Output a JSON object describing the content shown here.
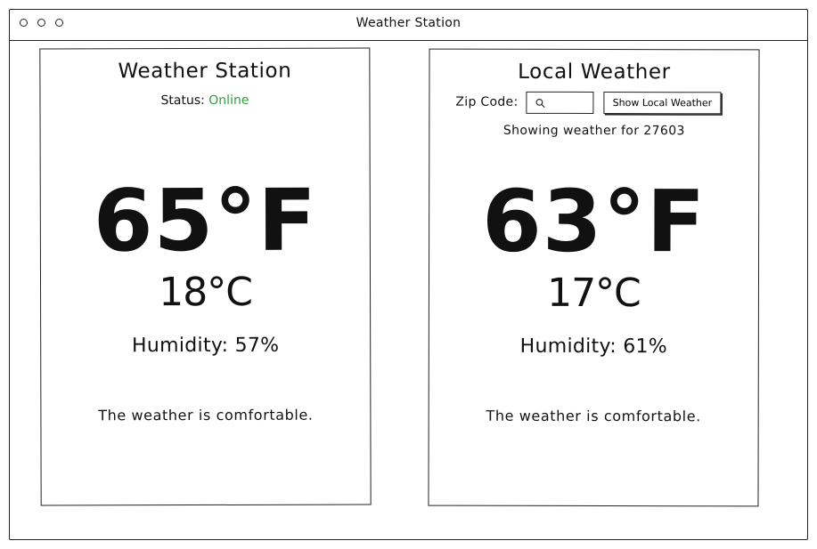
{
  "window": {
    "title": "Weather Station"
  },
  "station": {
    "title": "Weather Station",
    "status_label": "Status:",
    "status_value": "Online",
    "temp_f": "65°F",
    "temp_c": "18°C",
    "humidity": "Humidity: 57%",
    "comfort": "The weather is comfortable."
  },
  "local": {
    "title": "Local Weather",
    "zip_label": "Zip Code:",
    "zip_value": "",
    "zip_placeholder": "",
    "button_label": "Show Local Weather",
    "showing": "Showing weather for 27603",
    "temp_f": "63°F",
    "temp_c": "17°C",
    "humidity": "Humidity: 61%",
    "comfort": "The weather is comfortable."
  },
  "colors": {
    "status_online": "#2f9e3d",
    "ink": "#111111"
  },
  "icons": [
    "window-control-icon",
    "search-icon"
  ]
}
